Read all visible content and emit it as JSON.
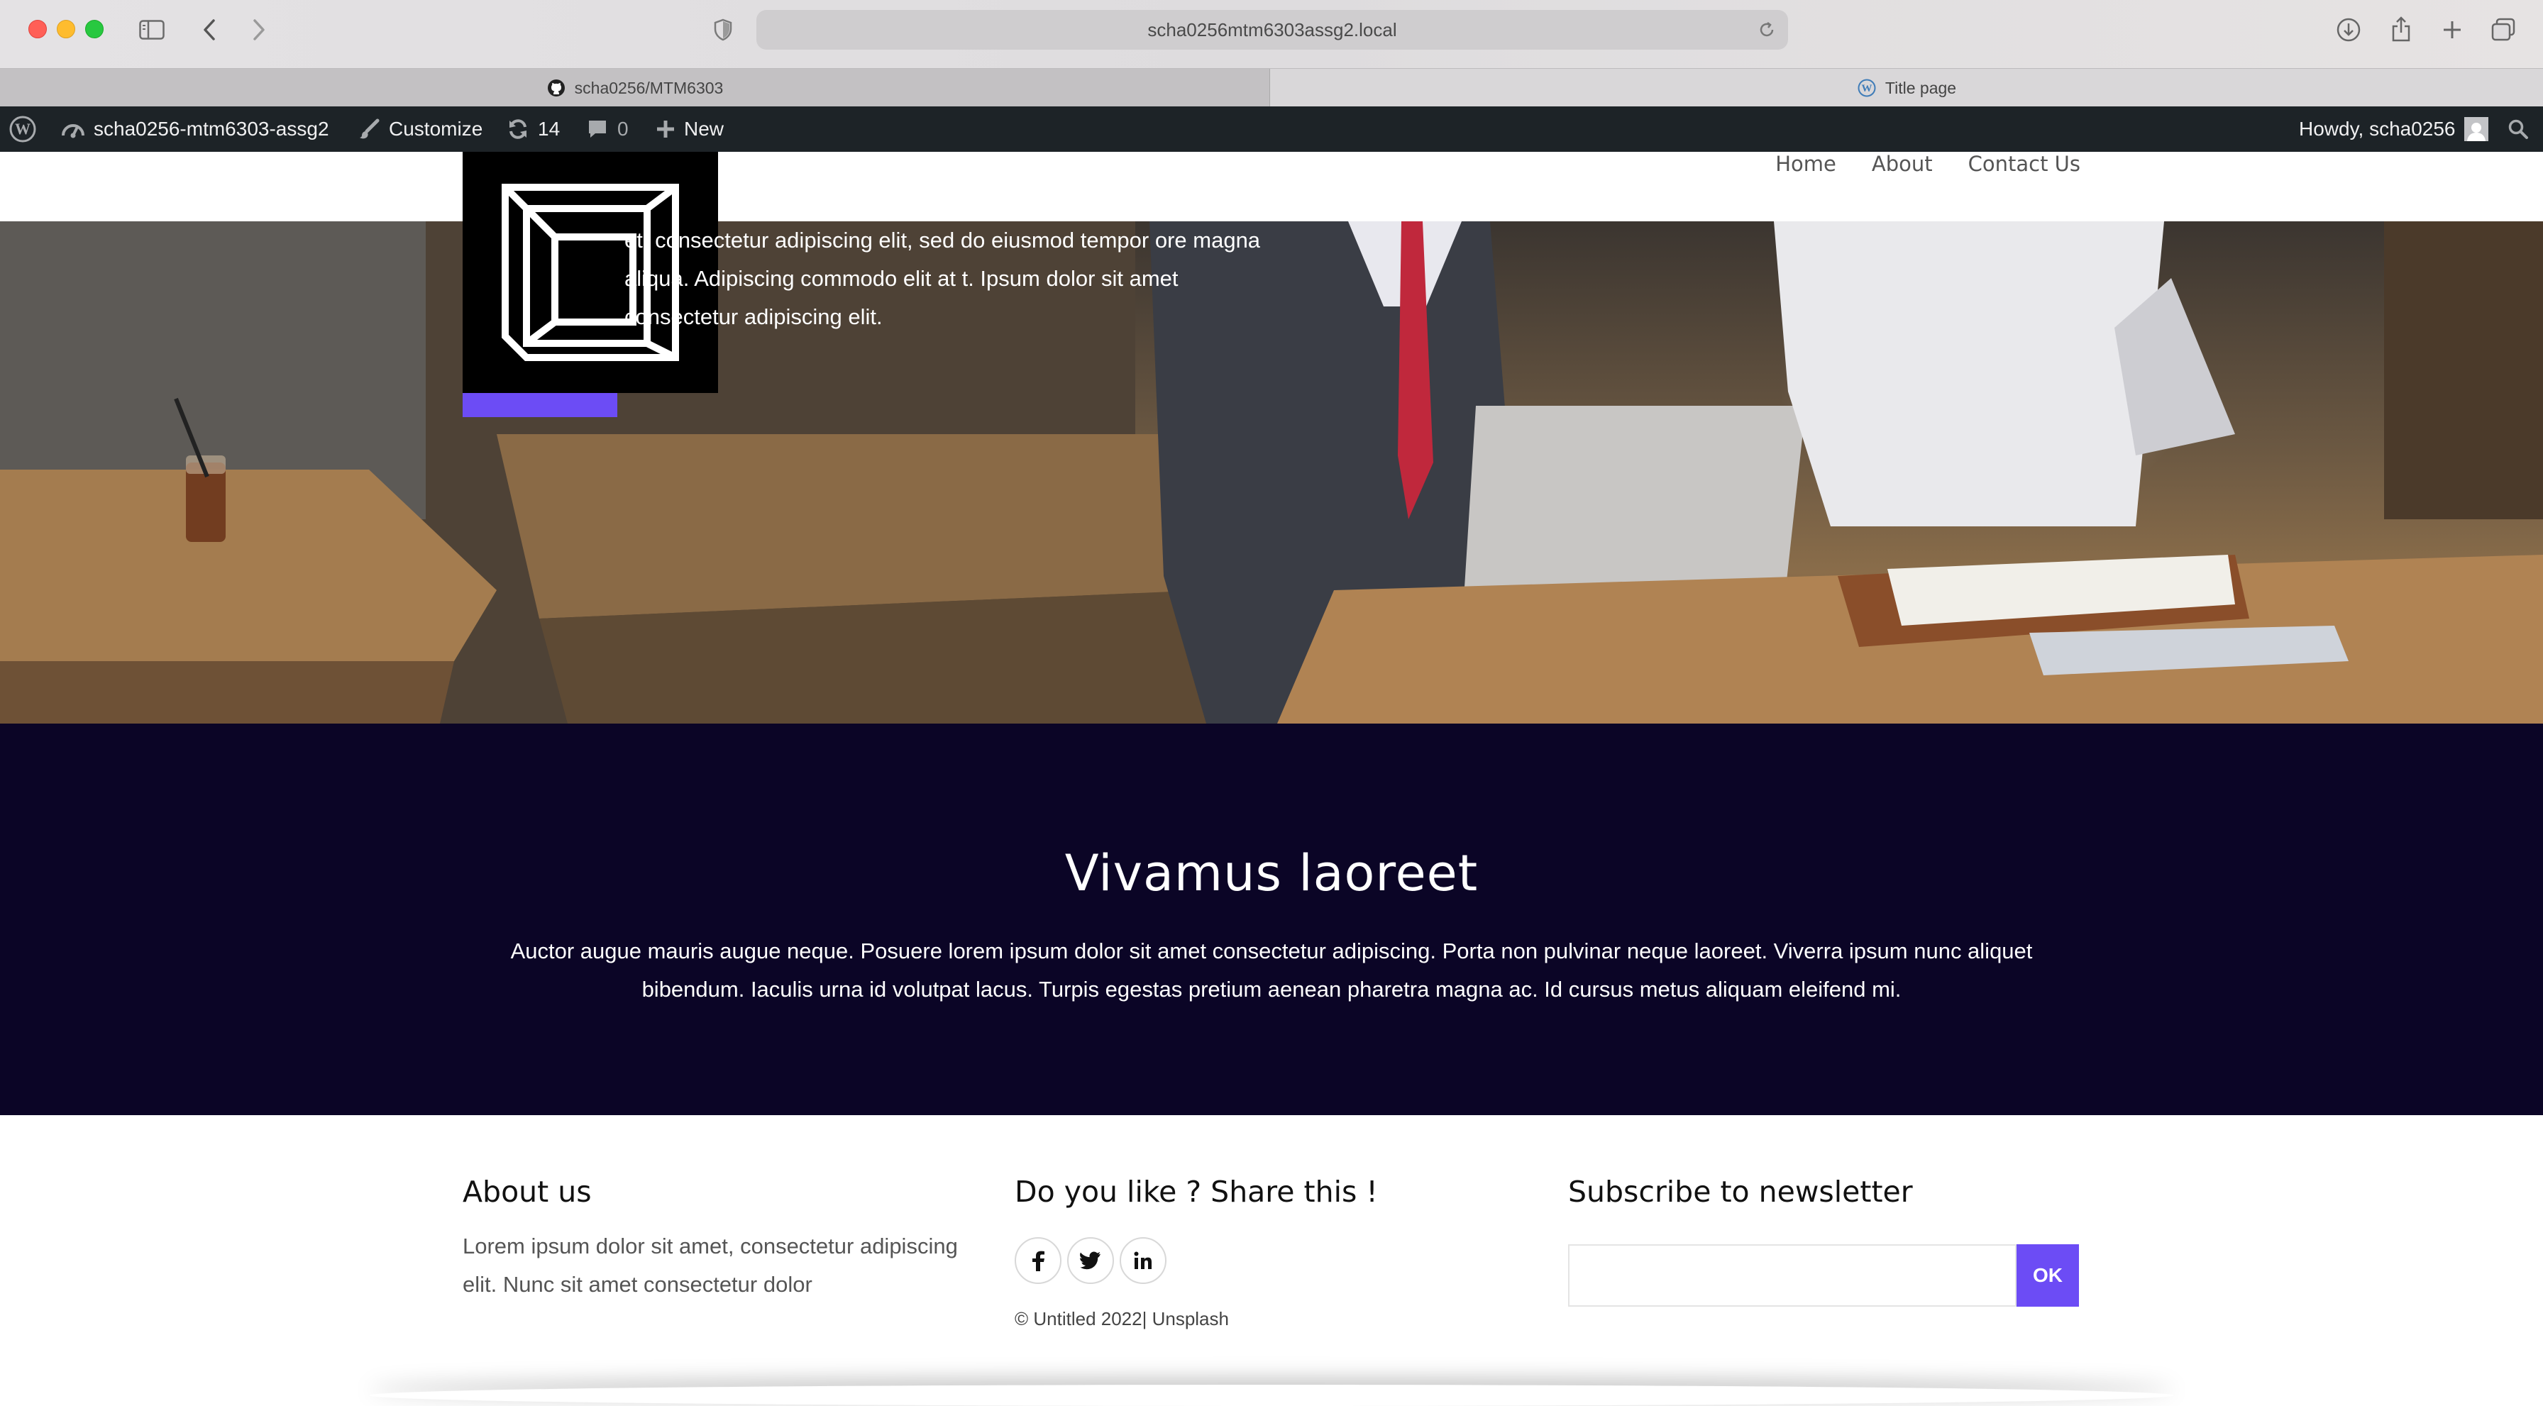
{
  "browser": {
    "url": "scha0256mtm6303assg2.local",
    "tabs": [
      {
        "label": "scha0256/MTM6303",
        "icon": "github-icon"
      },
      {
        "label": "Title page",
        "icon": "wordpress-icon"
      }
    ]
  },
  "admin_bar": {
    "site_name": "scha0256-mtm6303-assg2",
    "customize": "Customize",
    "updates_count": "14",
    "comments_count": "0",
    "new_label": "New",
    "howdy": "Howdy, scha0256"
  },
  "nav": {
    "items": [
      "Home",
      "About",
      "Contact Us"
    ]
  },
  "hero": {
    "text": "et, consectetur adipiscing elit, sed do eiusmod tempor ore magna aliqua. Adipiscing commodo elit at t. Ipsum dolor sit amet consectetur adipiscing elit."
  },
  "section": {
    "title": "Vivamus laoreet",
    "body": "Auctor augue mauris augue neque. Posuere lorem ipsum dolor sit amet consectetur adipiscing. Porta non pulvinar neque laoreet. Viverra ipsum nunc aliquet bibendum. Iaculis urna id volutpat lacus. Turpis egestas pretium aenean pharetra magna ac. Id cursus metus aliquam eleifend mi."
  },
  "footer": {
    "about_title": "About us",
    "about_text": "Lorem ipsum dolor sit amet, consectetur adipiscing elit. Nunc sit amet consectetur dolor",
    "share_title": "Do you like ? Share this !",
    "social": [
      "facebook-icon",
      "twitter-icon",
      "linkedin-icon"
    ],
    "copyright": "© Untitled 2022| Unsplash",
    "newsletter_title": "Subscribe to newsletter",
    "newsletter_value": "",
    "ok_label": "OK"
  },
  "colors": {
    "accent": "#6c4cf5",
    "dark_section": "#0b0526",
    "admin_bar": "#1d2327"
  }
}
